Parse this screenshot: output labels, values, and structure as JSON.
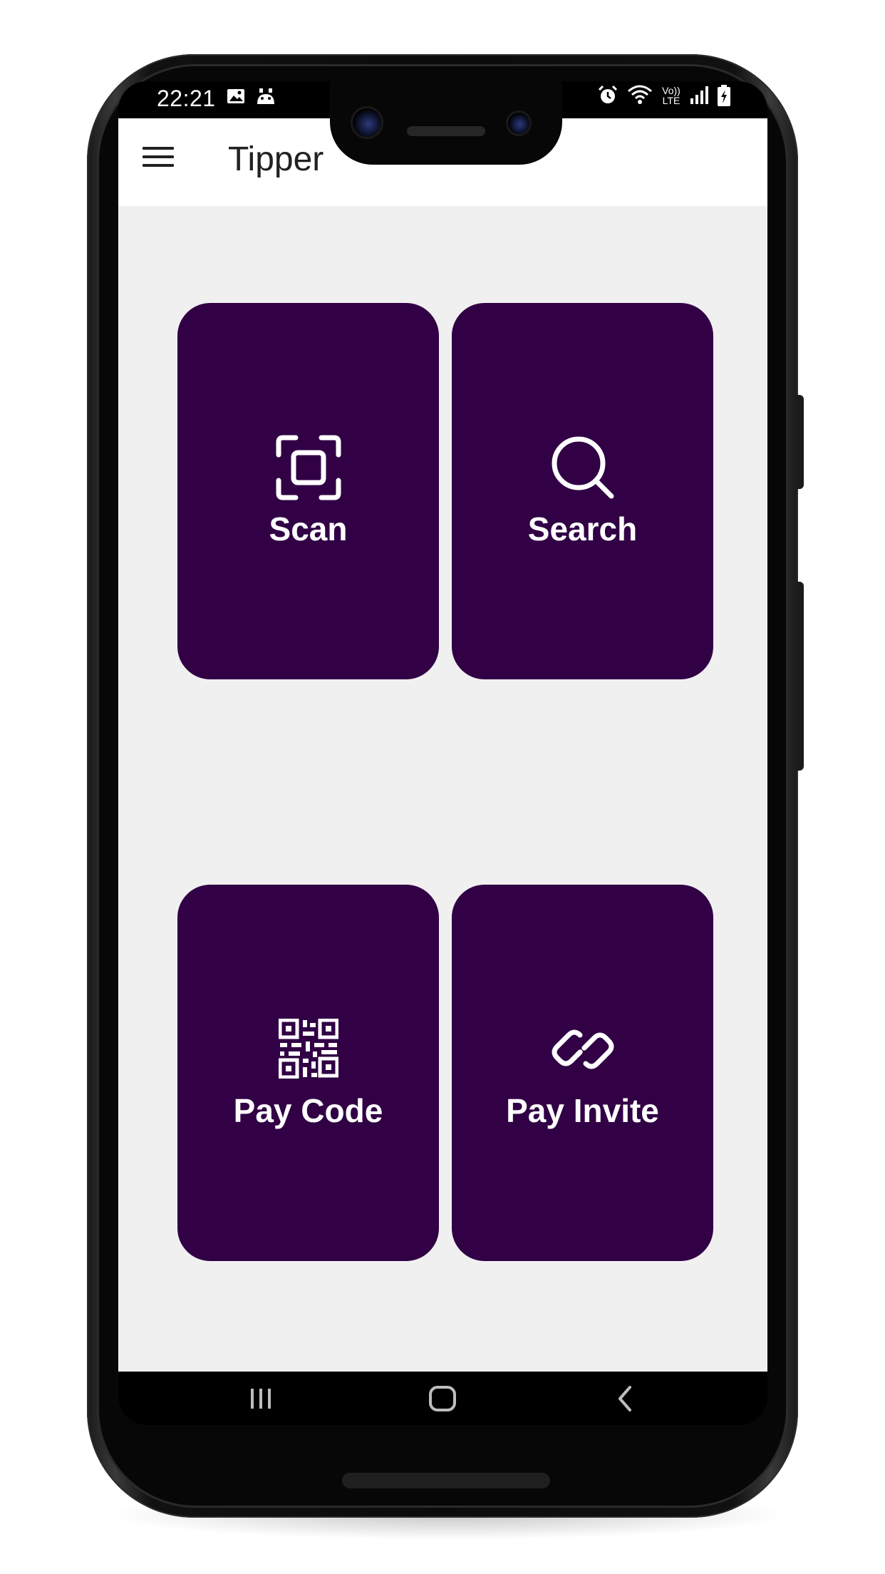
{
  "status_bar": {
    "time": "22:21",
    "left_icons": [
      "image-icon",
      "notification-icon"
    ],
    "right_icons": [
      "alarm-icon",
      "wifi-icon",
      "volte-lte-icon",
      "signal-icon",
      "battery-charging-icon"
    ],
    "volte_text": "Vo)) LTE"
  },
  "toolbar": {
    "title": "Tipper",
    "menu_icon": "hamburger-menu-icon"
  },
  "tiles": [
    {
      "label": "Scan",
      "icon": "scan-frame-icon"
    },
    {
      "label": "Search",
      "icon": "magnifier-icon"
    },
    {
      "label": "Pay Code",
      "icon": "qr-code-icon"
    },
    {
      "label": "Pay Invite",
      "icon": "link-icon"
    }
  ],
  "nav_bar": {
    "buttons": [
      "recent-apps-icon",
      "home-icon",
      "back-icon"
    ]
  },
  "colors": {
    "tile_bg": "#310045",
    "app_bg": "#f1f0f1",
    "toolbar_bg": "#ffffff",
    "text_dark": "#212121"
  }
}
